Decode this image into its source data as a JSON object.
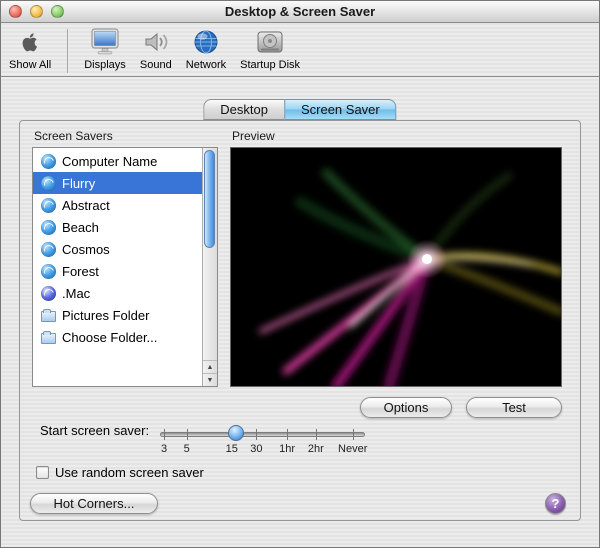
{
  "window": {
    "title": "Desktop & Screen Saver"
  },
  "colors": {
    "selection_blue": "#3875d7",
    "active_tab_blue": "#7cc4ee",
    "help_purple": "#7b52a1"
  },
  "toolbar": {
    "items": [
      {
        "label": "Show All",
        "icon": "apple-icon"
      },
      {
        "label": "Displays",
        "icon": "display-icon"
      },
      {
        "label": "Sound",
        "icon": "speaker-icon"
      },
      {
        "label": "Network",
        "icon": "globe-icon"
      },
      {
        "label": "Startup Disk",
        "icon": "disk-icon"
      }
    ]
  },
  "tabs": [
    {
      "label": "Desktop",
      "active": false
    },
    {
      "label": "Screen Saver",
      "active": true
    }
  ],
  "screensavers": {
    "heading": "Screen Savers",
    "items": [
      {
        "label": "Computer Name",
        "icon": "swirl-icon",
        "selected": false
      },
      {
        "label": "Flurry",
        "icon": "swirl-icon",
        "selected": true
      },
      {
        "label": "Abstract",
        "icon": "swirl-icon",
        "selected": false
      },
      {
        "label": "Beach",
        "icon": "swirl-icon",
        "selected": false
      },
      {
        "label": "Cosmos",
        "icon": "swirl-icon",
        "selected": false
      },
      {
        "label": "Forest",
        "icon": "swirl-icon",
        "selected": false
      },
      {
        "label": ".Mac",
        "icon": "mac-globe-icon",
        "selected": false
      },
      {
        "label": "Pictures Folder",
        "icon": "folder-icon",
        "selected": false
      },
      {
        "label": "Choose Folder...",
        "icon": "folder-icon",
        "selected": false
      }
    ]
  },
  "preview": {
    "heading": "Preview"
  },
  "buttons": {
    "options": "Options",
    "test": "Test",
    "hot_corners": "Hot Corners...",
    "help": "?"
  },
  "slider": {
    "label": "Start screen saver:",
    "ticks": [
      "3",
      "5",
      "15",
      "30",
      "1hr",
      "2hr",
      "Never"
    ],
    "value": "15"
  },
  "checkbox": {
    "label": "Use random screen saver",
    "checked": false
  }
}
